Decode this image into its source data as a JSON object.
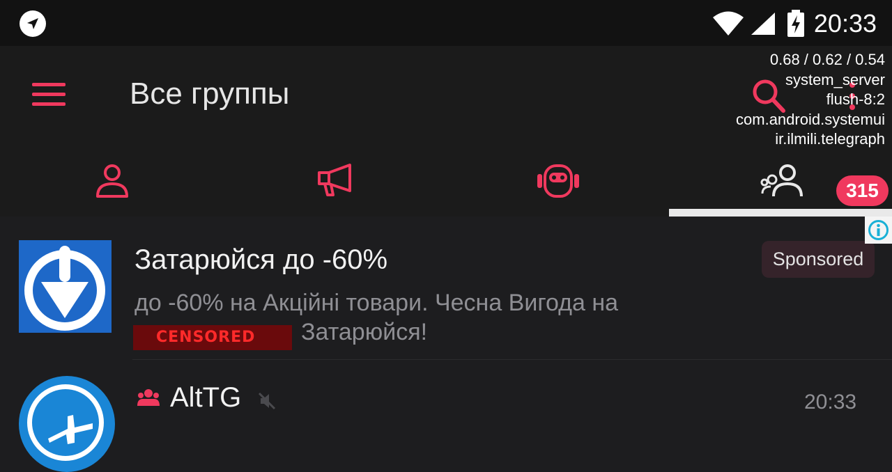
{
  "status_bar": {
    "time": "20:33",
    "icons": [
      "navigation-icon",
      "wifi-icon",
      "cell-signal-icon",
      "battery-charging-icon"
    ]
  },
  "toolbar": {
    "title": "Все группы",
    "menu_icon": "menu-icon",
    "search_icon": "search-icon",
    "accent_color": "#f0395e"
  },
  "debug_overlay": {
    "lines": [
      "0.68 / 0.62 / 0.54",
      "system_server",
      "flush-8:2",
      "com.android.systemui",
      "ir.ilmili.telegraph"
    ]
  },
  "tabs": [
    {
      "icon": "user-icon",
      "active": false
    },
    {
      "icon": "megaphone-icon",
      "active": false
    },
    {
      "icon": "bot-icon",
      "active": false
    },
    {
      "icon": "group-icon",
      "active": true,
      "badge": "315"
    }
  ],
  "ad": {
    "title": "Затарюйся до -60%",
    "description_line1": "до -60% на Акційні товари. Чесна Вигода на",
    "description_line2": "Затарюйся!",
    "censored_label": "CENSORED",
    "sponsored_label": "Sponsored"
  },
  "chats": [
    {
      "name": "AltTG",
      "time": "20:33",
      "is_group": true,
      "muted": true
    }
  ]
}
